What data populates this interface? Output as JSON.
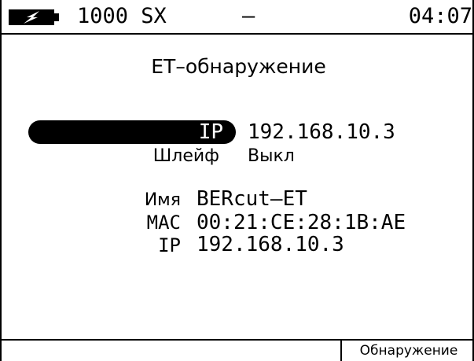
{
  "status_bar": {
    "battery_icon": "battery-charging-icon",
    "device": "1000 SX",
    "mode": "–",
    "time": "04:07"
  },
  "screen": {
    "title": "ET–обнаружение",
    "target_ip_label": "IP",
    "target_ip_value": "192.168.10.3",
    "loop_label": "Шлейф",
    "loop_value": "Выкл",
    "device_info": {
      "name_label": "Имя",
      "name_value": "BERcut–ET",
      "mac_label": "MAC",
      "mac_value": "00:21:CE:28:1B:AE",
      "ip_label": "IP",
      "ip_value": "192.168.10.3"
    }
  },
  "softkeys": {
    "right": "Обнаружение"
  },
  "colors": {
    "foreground": "#000000",
    "background": "#ffffff"
  }
}
